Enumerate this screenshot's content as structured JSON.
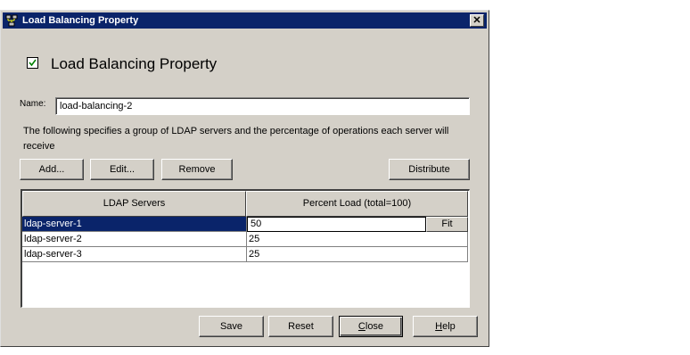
{
  "window": {
    "title": "Load Balancing Property",
    "close_glyph": "✕"
  },
  "header": {
    "enabled_checked": true,
    "title": "Load Balancing Property"
  },
  "name_field": {
    "label": "Name:",
    "value": "load-balancing-2"
  },
  "description": "The following specifies a group of LDAP servers and the percentage of operations each server will receive",
  "toolbar": {
    "add": "Add...",
    "edit": "Edit...",
    "remove": "Remove",
    "distribute": "Distribute"
  },
  "table": {
    "columns": [
      "LDAP Servers",
      "Percent Load  (total=100)"
    ],
    "rows": [
      {
        "server": "ldap-server-1",
        "percent": "50"
      },
      {
        "server": "ldap-server-2",
        "percent": "25"
      },
      {
        "server": "ldap-server-3",
        "percent": "25"
      }
    ],
    "fit_label": "Fit"
  },
  "footer": {
    "save": "Save",
    "reset": "Reset",
    "close_mnemonic": "C",
    "close_rest": "lose",
    "help_mnemonic": "H",
    "help_rest": "elp"
  },
  "colors": {
    "titlebar": "#0a246a",
    "dialog_bg": "#d4d0c8",
    "selection": "#0a246a"
  },
  "icons": {
    "app": "network-servers-icon",
    "checkbox": "checkmark-icon"
  }
}
